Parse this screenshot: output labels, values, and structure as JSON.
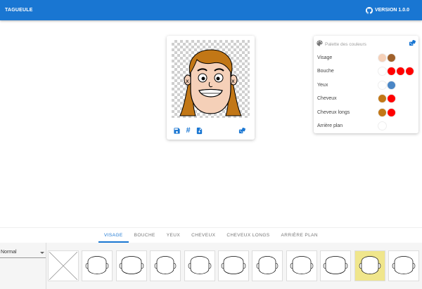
{
  "app": {
    "title": "TAGUEULE",
    "version": "VERSION 1.0.0"
  },
  "colors": {
    "primary": "#1976d2",
    "selected_thumb": "#f0e68c"
  },
  "preview": {
    "actions": [
      {
        "name": "save-icon"
      },
      {
        "name": "hash-icon",
        "glyph": "#"
      },
      {
        "name": "download-file-icon"
      },
      {
        "name": "dice-icon"
      }
    ]
  },
  "palette": {
    "title": "Palette des couleurs",
    "rows": [
      {
        "label": "Visage",
        "colors": [
          "#f5d0b8",
          "#a0612b"
        ]
      },
      {
        "label": "Bouche",
        "colors": [
          "#ffffff",
          "#ff0000",
          "#ff0000",
          "#ff0000"
        ]
      },
      {
        "label": "Yeux",
        "colors": [
          "#ffffff",
          "#4a86c5"
        ]
      },
      {
        "label": "Cheveux",
        "colors": [
          "#c27716",
          "#ff0000"
        ]
      },
      {
        "label": "Cheveux longs",
        "colors": [
          "#c27716",
          "#ff0000"
        ]
      },
      {
        "label": "Arrière plan",
        "colors": [
          "#ffffff"
        ]
      }
    ]
  },
  "tabs": [
    "VISAGE",
    "BOUCHE",
    "YEUX",
    "CHEVEUX",
    "CHEVEUX LONGS",
    "ARRIÈRE PLAN"
  ],
  "active_tab": "VISAGE",
  "filter": {
    "value": "Normal"
  },
  "thumbnails": {
    "count": 11,
    "selected_index": 9
  }
}
